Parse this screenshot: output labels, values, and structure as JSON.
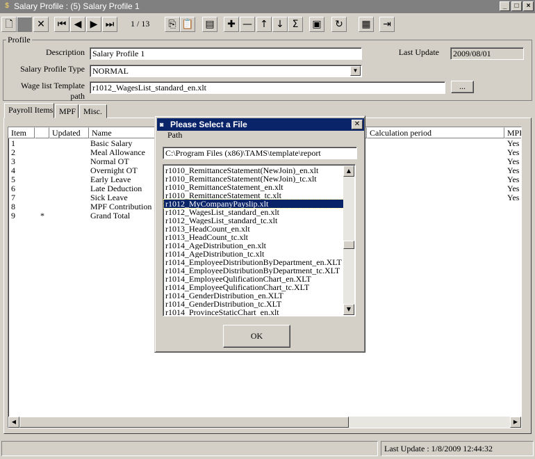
{
  "window": {
    "title": "Salary Profile : (5) Salary Profile 1",
    "controls": [
      "_",
      "□",
      "×"
    ]
  },
  "toolbar": {
    "record_counter": "1 / 13",
    "buttons": [
      {
        "name": "new-icon",
        "glyph": "🗋"
      },
      {
        "name": "save-icon",
        "glyph": ""
      },
      {
        "name": "delete-icon",
        "glyph": "✕"
      },
      {
        "name": "first-record-icon",
        "glyph": "⏮"
      },
      {
        "name": "previous-record-icon",
        "glyph": "◀"
      },
      {
        "name": "next-record-icon",
        "glyph": "▶"
      },
      {
        "name": "last-record-icon",
        "glyph": "⏭"
      },
      {
        "name": "copy-icon",
        "glyph": "⎘"
      },
      {
        "name": "paste-icon",
        "glyph": "📋"
      },
      {
        "name": "export-icon",
        "glyph": "▤"
      },
      {
        "name": "add-row-icon",
        "glyph": "✚"
      },
      {
        "name": "remove-row-icon",
        "glyph": "—"
      },
      {
        "name": "move-up-icon",
        "glyph": "↑"
      },
      {
        "name": "move-down-icon",
        "glyph": "↓"
      },
      {
        "name": "sum-icon",
        "glyph": "Σ"
      },
      {
        "name": "print-icon",
        "glyph": "▣"
      },
      {
        "name": "refresh-icon",
        "glyph": "↻"
      },
      {
        "name": "calculator-icon",
        "glyph": "▦"
      },
      {
        "name": "exit-icon",
        "glyph": "⇥"
      }
    ]
  },
  "profile": {
    "legend": "Profile",
    "description_label": "Description",
    "description_value": "Salary Profile 1",
    "last_update_label": "Last Update",
    "last_update_value": "2009/08/01",
    "type_label": "Salary Profile Type",
    "type_value": "NORMAL",
    "template_label": "Wage list Template path",
    "template_value": "r1012_WagesList_standard_en.xlt",
    "browse_label": "..."
  },
  "tabs": [
    {
      "label": "Payroll Items"
    },
    {
      "label": "MPF"
    },
    {
      "label": "Misc."
    }
  ],
  "grid": {
    "columns": [
      "Item",
      "",
      "Updated",
      "Name",
      "Calculation period",
      "MPF"
    ],
    "rows": [
      {
        "item": "1",
        "updated": "",
        "name": "Basic Salary",
        "mpf": "Yes"
      },
      {
        "item": "2",
        "updated": "",
        "name": "Meal Allowance",
        "mpf": "Yes"
      },
      {
        "item": "3",
        "updated": "",
        "name": "Normal OT",
        "mpf": "Yes"
      },
      {
        "item": "4",
        "updated": "",
        "name": "Overnight OT",
        "mpf": "Yes"
      },
      {
        "item": "5",
        "updated": "",
        "name": "Early Leave",
        "mpf": "Yes"
      },
      {
        "item": "6",
        "updated": "",
        "name": "Late Deduction",
        "mpf": "Yes"
      },
      {
        "item": "7",
        "updated": "",
        "name": "Sick Leave",
        "mpf": "Yes"
      },
      {
        "item": "8",
        "updated": "",
        "name": "MPF Contribution",
        "mpf": ""
      },
      {
        "item": "9",
        "updated": "*",
        "name": "Grand Total",
        "mpf": ""
      }
    ]
  },
  "status": {
    "left": "",
    "right": "Last Update : 1/8/2009 12:44:32"
  },
  "dialog": {
    "title": "Please Select a File",
    "path_label": "Path",
    "path_value": "C:\\Program Files (x86)\\TAMS\\template\\report",
    "ok_label": "OK",
    "selected_index": 4,
    "files": [
      "r1010_RemittanceStatement(NewJoin)_en.xlt",
      "r1010_RemittanceStatement(NewJoin)_tc.xlt",
      "r1010_RemittanceStatement_en.xlt",
      "r1010_RemittanceStatement_tc.xlt",
      "r1012_MyCompanyPayslip.xlt",
      "r1012_WagesList_standard_en.xlt",
      "r1012_WagesList_standard_tc.xlt",
      "r1013_HeadCount_en.xlt",
      "r1013_HeadCount_tc.xlt",
      "r1014_AgeDistribution_en.xlt",
      "r1014_AgeDistribution_tc.xlt",
      "r1014_EmployeeDistributionByDepartment_en.XLT",
      "r1014_EmployeeDistributionByDepartment_tc.XLT",
      "r1014_EmployeeQulificationChart_en.XLT",
      "r1014_EmployeeQulificationChart_tc.XLT",
      "r1014_GenderDistribution_en.XLT",
      "r1014_GenderDistribution_tc.XLT",
      "r1014_ProvinceStaticChart_en.xlt"
    ]
  }
}
